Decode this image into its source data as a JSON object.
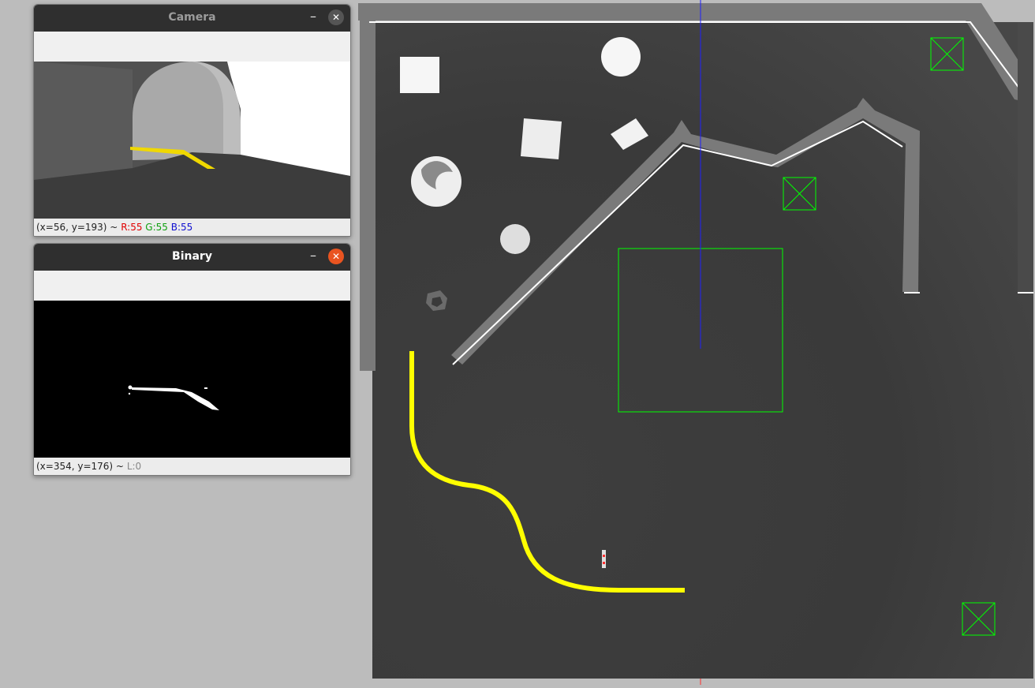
{
  "camera_window": {
    "title": "Camera",
    "minimize": "–",
    "close": "✕",
    "status_coords": "(x=56, y=193) ~",
    "status_r": "R:55",
    "status_g": "G:55",
    "status_b": "B:55",
    "colors": {
      "r": "#e00000",
      "g": "#10a010",
      "b": "#1010d0"
    }
  },
  "binary_window": {
    "title": "Binary",
    "minimize": "–",
    "close": "✕",
    "status_coords": "(x=354, y=176) ~",
    "status_l": "L:0",
    "close_color": "#e95420"
  },
  "simulation": {
    "floor_color": "#3a3a3a",
    "line_color": "#ffff00",
    "wall_color": "#7a7a7a",
    "marker_color": "#00ff00",
    "axis_color": "#2020ff"
  }
}
